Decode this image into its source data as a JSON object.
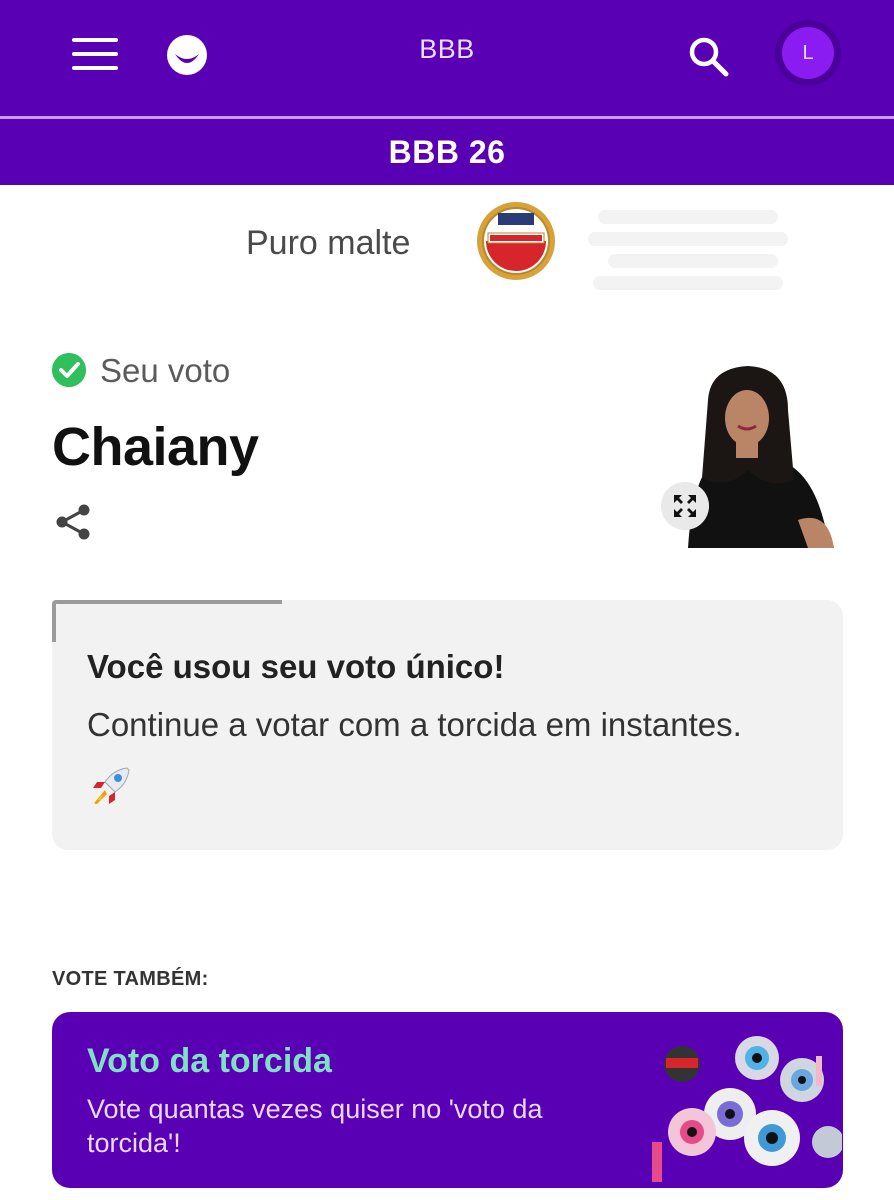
{
  "header": {
    "title": "BBB",
    "avatar_initial": "L",
    "colors": {
      "bar": "#5a00b4",
      "avatar": "#8a1cf2"
    },
    "icons": [
      "menu-icon",
      "globo-logo-icon",
      "search-icon"
    ]
  },
  "subheader": {
    "label": "BBB 26"
  },
  "sponsor": {
    "text": "Puro malte",
    "logo_name": "amistel-lager-logo"
  },
  "vote": {
    "status": "Seu voto",
    "name": "Chaiany"
  },
  "notice": {
    "heading": "Você usou seu voto único!",
    "body": "Continue a votar com a torcida em instantes.",
    "emoji": "🚀"
  },
  "vote_also": {
    "label": "VOTE TAMBÉM:",
    "card": {
      "title": "Voto da torcida",
      "description": "Vote quantas vezes quiser no 'voto da torcida'!",
      "colors": {
        "background": "#5a00b4",
        "title": "#7fe0c4"
      }
    }
  }
}
